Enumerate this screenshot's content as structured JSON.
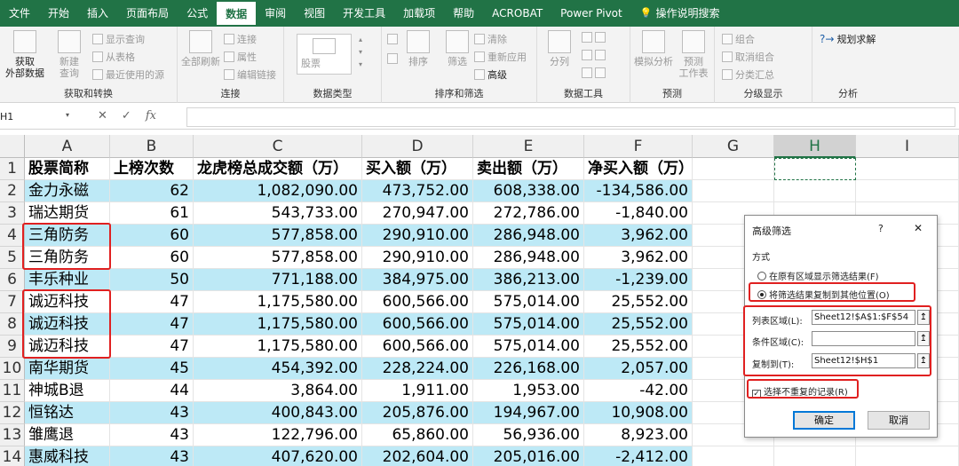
{
  "ribbon": {
    "tabs": [
      "文件",
      "开始",
      "插入",
      "页面布局",
      "公式",
      "数据",
      "审阅",
      "视图",
      "开发工具",
      "加载项",
      "帮助",
      "ACROBAT",
      "Power Pivot"
    ],
    "search_label": "操作说明搜索",
    "groups": {
      "get_transform": {
        "label": "获取和转换",
        "get_external": "获取\n外部数据",
        "new_query": "新建\n查询",
        "show_queries": "显示查询",
        "from_table": "从表格",
        "recent_sources": "最近使用的源"
      },
      "connections": {
        "label": "连接",
        "refresh_all": "全部刷新",
        "connections": "连接",
        "properties": "属性",
        "edit_links": "编辑链接"
      },
      "data_types": {
        "label": "数据类型",
        "stocks": "股票"
      },
      "sort_filter": {
        "label": "排序和筛选",
        "sort": "排序",
        "filter": "筛选",
        "clear": "清除",
        "reapply": "重新应用",
        "advanced": "高级"
      },
      "data_tools": {
        "label": "数据工具",
        "text_to_columns": "分列"
      },
      "forecast": {
        "label": "预测",
        "what_if": "模拟分析",
        "forecast_sheet": "预测\n工作表"
      },
      "outline": {
        "label": "分级显示",
        "group": "组合",
        "ungroup": "取消组合",
        "subtotal": "分类汇总"
      },
      "analyze": {
        "label": "分析",
        "solver": "规划求解"
      }
    }
  },
  "formula_bar": {
    "name_box": "H1",
    "fx": "fx",
    "cancel": "✕",
    "enter": "✓",
    "formula": ""
  },
  "sheet": {
    "columns": [
      "A",
      "B",
      "C",
      "D",
      "E",
      "F",
      "G",
      "H",
      "I"
    ],
    "selected_column": "H",
    "headers": [
      "股票简称",
      "上榜次数",
      "龙虎榜总成交额（万）",
      "买入额（万）",
      "卖出额（万）",
      "净买入额（万）"
    ],
    "rows": [
      [
        "金力永磁",
        "62",
        "1,082,090.00",
        "473,752.00",
        "608,338.00",
        "-134,586.00"
      ],
      [
        "瑞达期货",
        "61",
        "543,733.00",
        "270,947.00",
        "272,786.00",
        "-1,840.00"
      ],
      [
        "三角防务",
        "60",
        "577,858.00",
        "290,910.00",
        "286,948.00",
        "3,962.00"
      ],
      [
        "三角防务",
        "60",
        "577,858.00",
        "290,910.00",
        "286,948.00",
        "3,962.00"
      ],
      [
        "丰乐种业",
        "50",
        "771,188.00",
        "384,975.00",
        "386,213.00",
        "-1,239.00"
      ],
      [
        "诚迈科技",
        "47",
        "1,175,580.00",
        "600,566.00",
        "575,014.00",
        "25,552.00"
      ],
      [
        "诚迈科技",
        "47",
        "1,175,580.00",
        "600,566.00",
        "575,014.00",
        "25,552.00"
      ],
      [
        "诚迈科技",
        "47",
        "1,175,580.00",
        "600,566.00",
        "575,014.00",
        "25,552.00"
      ],
      [
        "南华期货",
        "45",
        "454,392.00",
        "228,224.00",
        "226,168.00",
        "2,057.00"
      ],
      [
        "神城B退",
        "44",
        "3,864.00",
        "1,911.00",
        "1,953.00",
        "-42.00"
      ],
      [
        "恒铭达",
        "43",
        "400,843.00",
        "205,876.00",
        "194,967.00",
        "10,908.00"
      ],
      [
        "雏鹰退",
        "43",
        "122,796.00",
        "65,860.00",
        "56,936.00",
        "8,923.00"
      ],
      [
        "惠威科技",
        "43",
        "407,620.00",
        "202,604.00",
        "205,016.00",
        "-2,412.00"
      ]
    ],
    "row_numbers": [
      "1",
      "2",
      "3",
      "4",
      "5",
      "6",
      "7",
      "8",
      "9",
      "10",
      "11",
      "12",
      "13",
      "14"
    ],
    "band_color": "#bde9f6",
    "highlight_color": "#e02020"
  },
  "dialog": {
    "title": "高级筛选",
    "help": "?",
    "close": "✕",
    "mode_label": "方式",
    "option_inplace": "在原有区域显示筛选结果(F)",
    "option_copy": "将筛选结果复制到其他位置(O)",
    "list_range_label": "列表区域(L):",
    "list_range_value": "Sheet12!$A$1:$F$54",
    "criteria_label": "条件区域(C):",
    "criteria_value": "",
    "copy_to_label": "复制到(T):",
    "copy_to_value": "Sheet12!$H$1",
    "unique_label": "选择不重复的记录(R)",
    "ok": "确定",
    "cancel": "取消",
    "collapse_icon": "↥"
  }
}
